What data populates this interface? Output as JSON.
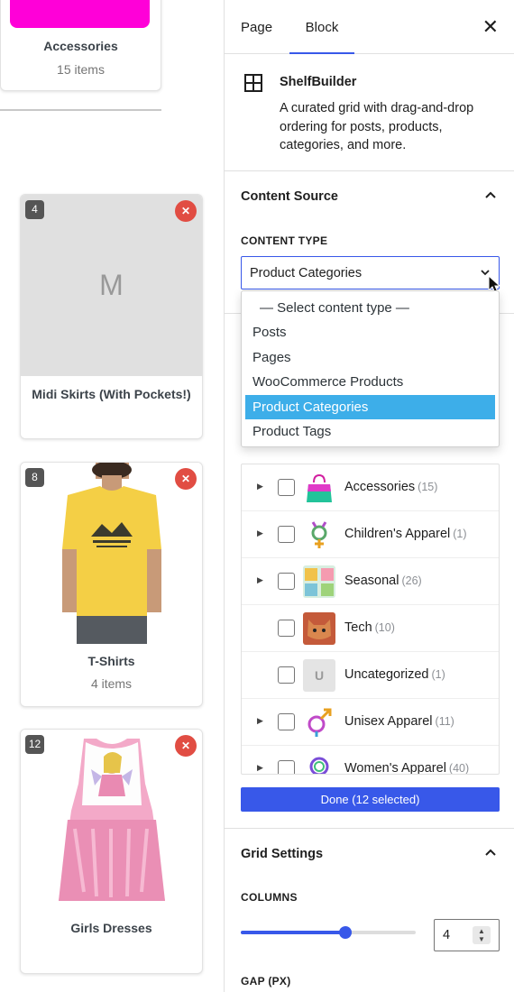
{
  "canvas": {
    "cards": [
      {
        "title": "Accessories",
        "sub": "15 items"
      },
      {
        "badge": "4",
        "placeholder": "M",
        "title": "Midi Skirts (With Pockets!)"
      },
      {
        "badge": "8",
        "title": "T-Shirts",
        "sub": "4 items"
      },
      {
        "badge": "12",
        "title": "Girls Dresses"
      }
    ],
    "remove_glyph": "✕"
  },
  "panel": {
    "tabs": [
      "Page",
      "Block"
    ],
    "active_tab": "Block",
    "close_glyph": "✕",
    "block": {
      "icon": "grid-icon",
      "name": "ShelfBuilder",
      "description": "A curated grid with drag-and-drop ordering for posts, products, categories, and more."
    },
    "content_source": {
      "title": "Content Source",
      "type_label": "CONTENT TYPE",
      "selected": "Product Categories",
      "options": [
        "— Select content type —",
        "Posts",
        "Pages",
        "WooCommerce Products",
        "Product Categories",
        "Product Tags"
      ],
      "terms": [
        {
          "name": "Accessories",
          "count": "(15)",
          "expandable": true,
          "thumb": "bag"
        },
        {
          "name": "Children's Apparel",
          "count": "(1)",
          "expandable": true,
          "thumb": "symbol"
        },
        {
          "name": "Seasonal",
          "count": "(26)",
          "expandable": true,
          "thumb": "poster"
        },
        {
          "name": "Tech",
          "count": "(10)",
          "expandable": false,
          "thumb": "cat"
        },
        {
          "name": "Uncategorized",
          "count": "(1)",
          "expandable": false,
          "thumb": "letter",
          "letter": "U"
        },
        {
          "name": "Unisex Apparel",
          "count": "(11)",
          "expandable": true,
          "thumb": "symbol2"
        },
        {
          "name": "Women's Apparel",
          "count": "(40)",
          "expandable": true,
          "thumb": "symbol3"
        }
      ],
      "done_label": "Done (12 selected)"
    },
    "grid_settings": {
      "title": "Grid Settings",
      "columns_label": "COLUMNS",
      "columns_value": "4",
      "columns_fraction": 0.6,
      "gap_label": "GAP (PX)"
    }
  }
}
